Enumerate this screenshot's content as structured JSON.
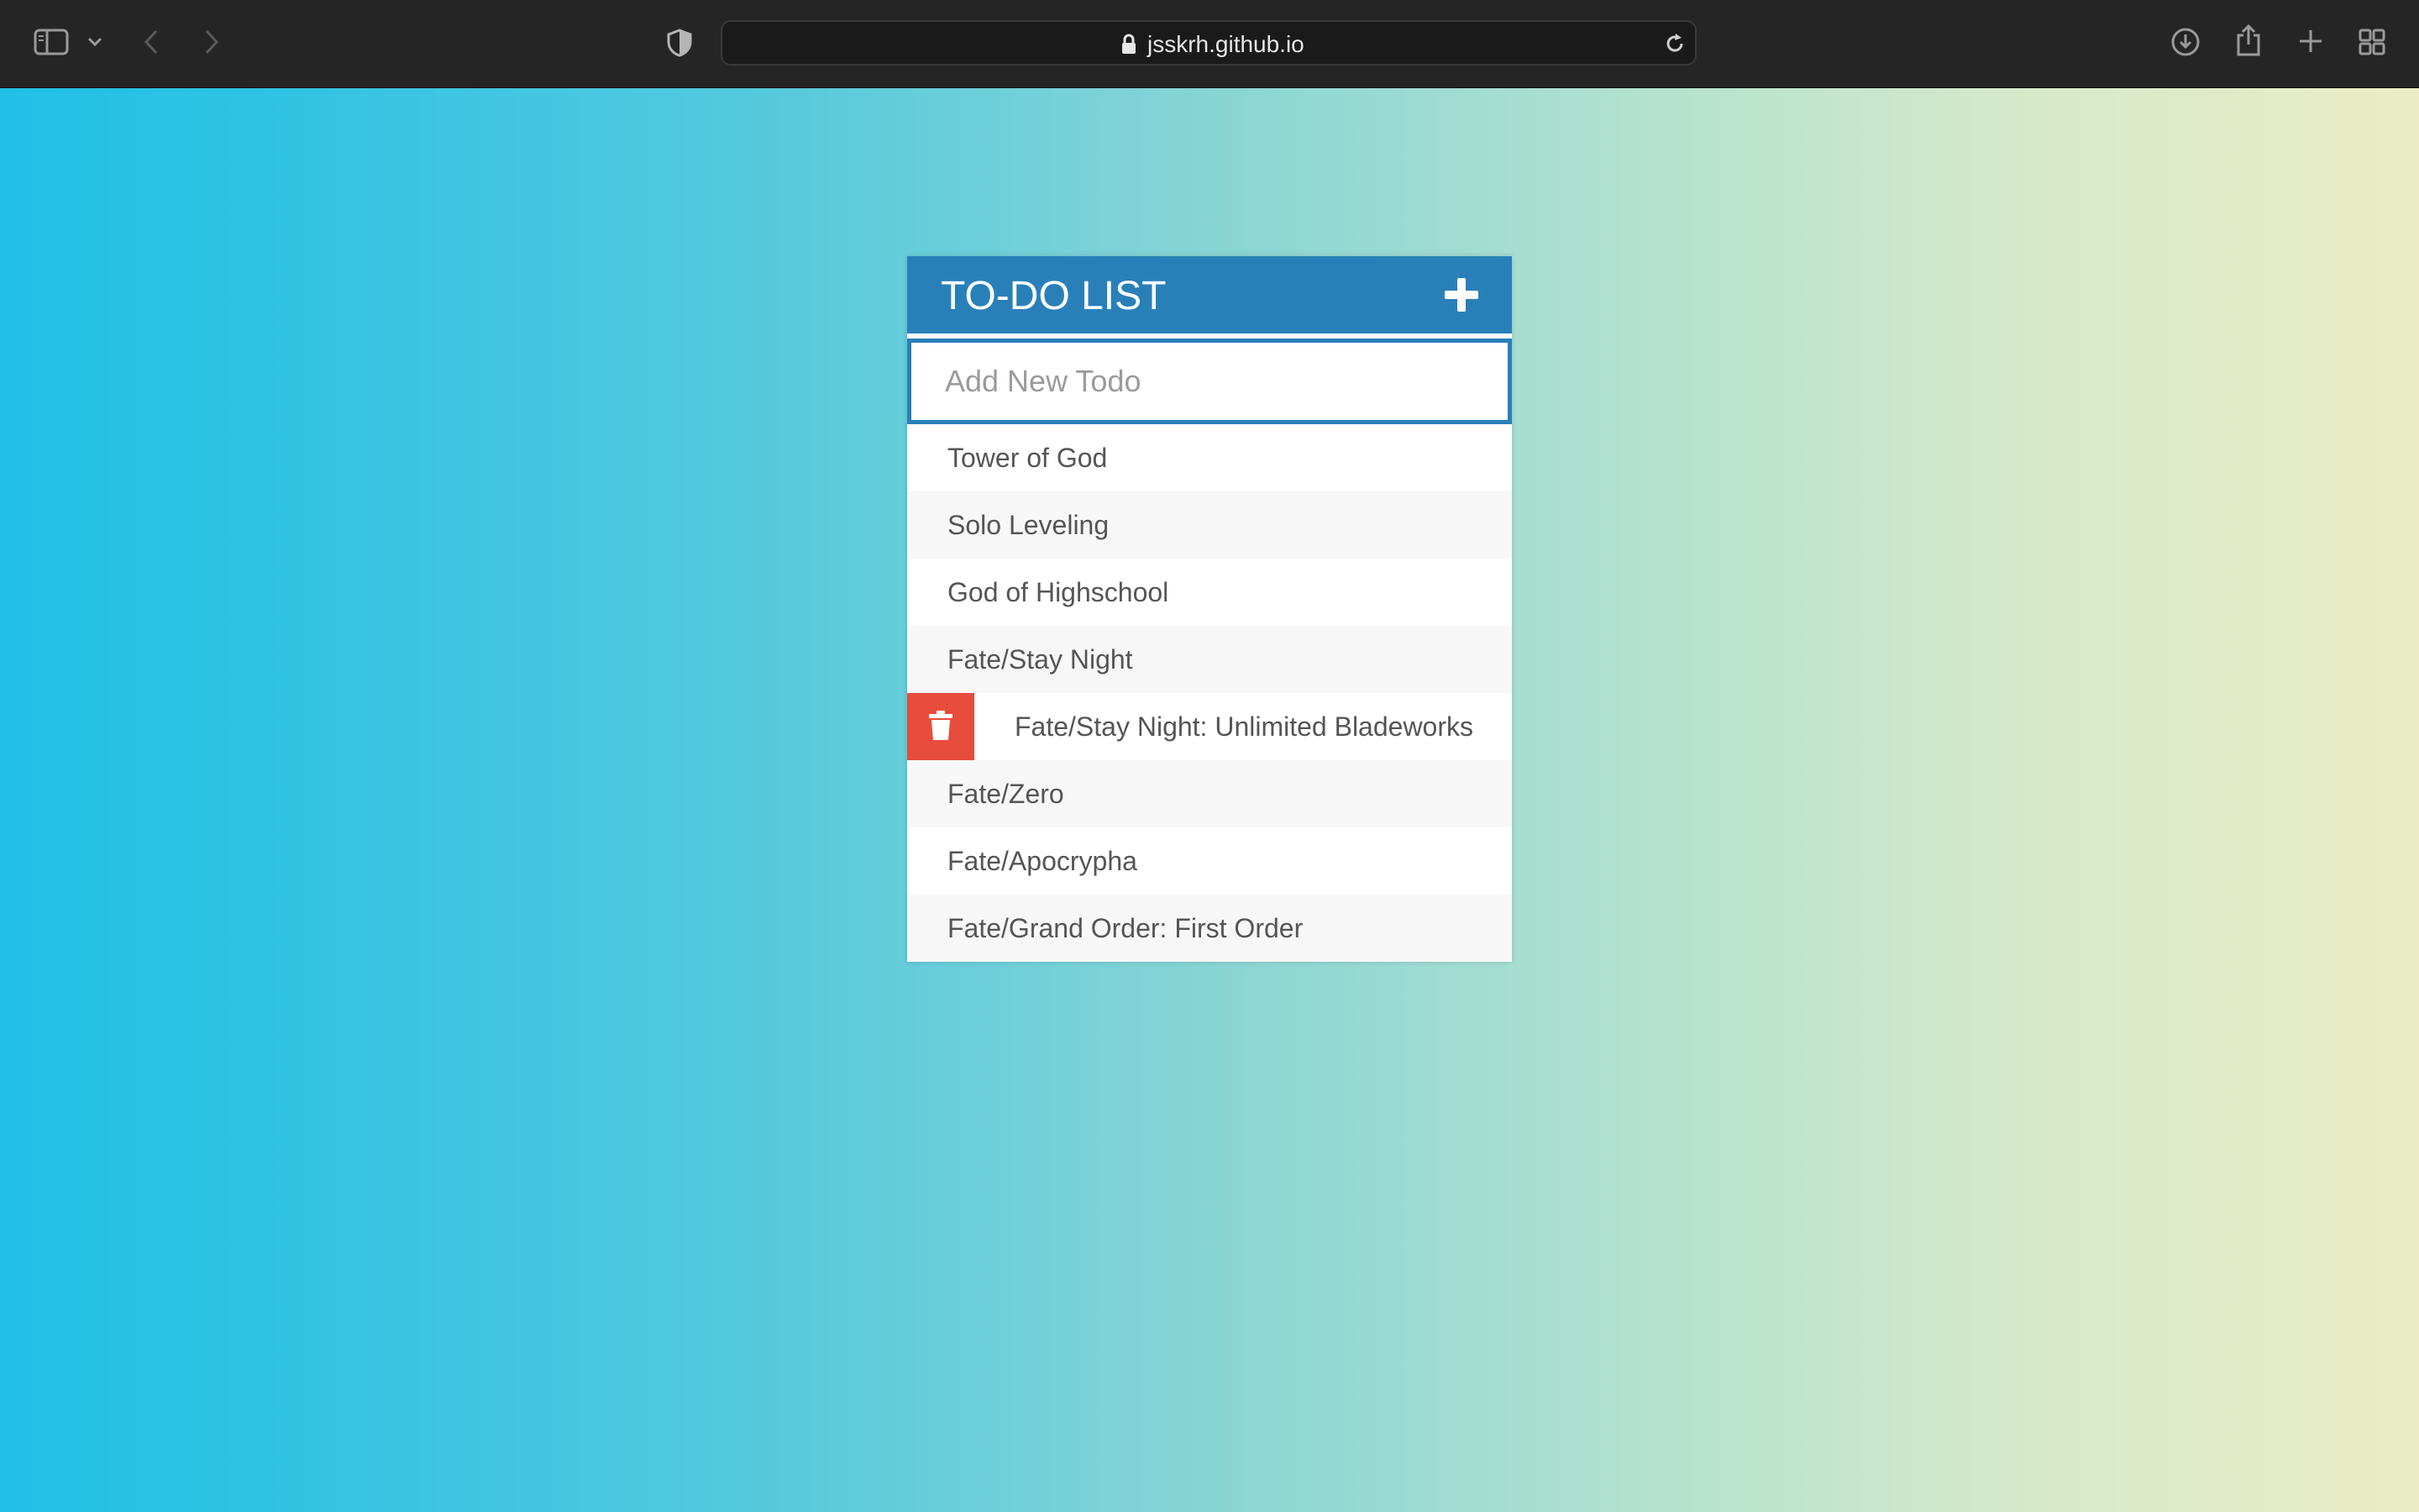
{
  "browser": {
    "url": "jsskrh.github.io",
    "icons": [
      "sidebar-icon",
      "chevron-down-icon",
      "back-icon",
      "forward-icon",
      "shield-icon",
      "lock-icon",
      "reload-icon",
      "download-icon",
      "share-icon",
      "new-tab-icon",
      "tab-overview-icon"
    ]
  },
  "app": {
    "title": "TO-DO LIST",
    "add_toggle_icon": "plus-icon",
    "input_placeholder": "Add New Todo",
    "input_value": "",
    "delete_icon": "trash-icon",
    "todos": [
      {
        "text": "Tower of God",
        "hovered": false
      },
      {
        "text": "Solo Leveling",
        "hovered": false
      },
      {
        "text": "God of Highschool",
        "hovered": false
      },
      {
        "text": "Fate/Stay Night",
        "hovered": false
      },
      {
        "text": "Fate/Stay Night: Unlimited Bladeworks",
        "hovered": true
      },
      {
        "text": "Fate/Zero",
        "hovered": false
      },
      {
        "text": "Fate/Apocrypha",
        "hovered": false
      },
      {
        "text": "Fate/Grand Order: First Order",
        "hovered": false
      }
    ]
  },
  "colors": {
    "header": "#2980b9",
    "delete": "#e74c3c",
    "gradient_left": "#22bfe6",
    "gradient_right": "#ebecc6"
  }
}
